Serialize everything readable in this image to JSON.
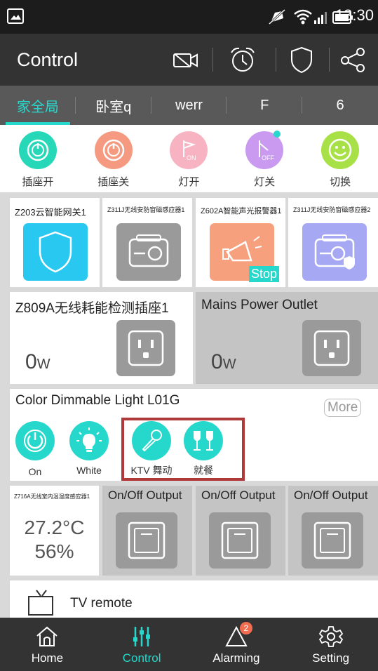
{
  "status_bar": {
    "time": "13:30"
  },
  "app_bar": {
    "title": "Control"
  },
  "tabs": [
    {
      "label": "家全局",
      "active": true
    },
    {
      "label": "卧室q"
    },
    {
      "label": "werr"
    },
    {
      "label": "F"
    },
    {
      "label": "6"
    }
  ],
  "scenes": [
    {
      "label": "插座开",
      "color": "#26d8b8",
      "icon": "power-on-icon"
    },
    {
      "label": "插座关",
      "color": "#f59a80",
      "icon": "power-off-icon"
    },
    {
      "label": "灯开",
      "color": "#f8b3c2",
      "icon": "light-on-icon",
      "icon_text": "ON"
    },
    {
      "label": "灯关",
      "color": "#c99af0",
      "icon": "light-off-icon",
      "icon_text": "OFF"
    },
    {
      "label": "切换",
      "color": "#a8e048",
      "icon": "smiley-icon"
    }
  ],
  "devices_row1": [
    {
      "title": "Z203云智能网关1",
      "tile_color": "#29c8f0",
      "icon": "shield-icon"
    },
    {
      "title": "Z311J无线安防窗磁感应器1",
      "tile_color": "#9a9a9a",
      "icon": "door-sensor-icon"
    },
    {
      "title": "Z602A智能声光报警器1",
      "tile_color": "#f7a07d",
      "icon": "megaphone-icon",
      "badge": "Stop"
    },
    {
      "title": "Z311J无线安防窗磁感应器2",
      "tile_color": "#a6a8f3",
      "icon": "door-sensor-shield-icon"
    }
  ],
  "outlets": [
    {
      "title": "Z809A无线耗能检测插座1",
      "value": "0",
      "unit": "W"
    },
    {
      "title": "Mains Power Outlet",
      "value": "0",
      "unit": "W"
    }
  ],
  "light": {
    "title": "Color Dimmable Light L01G",
    "more": "More",
    "buttons": [
      {
        "label": "On",
        "icon": "power-icon"
      },
      {
        "label": "White",
        "icon": "bulb-icon"
      },
      {
        "label": "KTV 舞动",
        "icon": "microphone-icon"
      },
      {
        "label": "就餐",
        "icon": "wine-glasses-icon"
      }
    ]
  },
  "sensor": {
    "title": "Z716A无线室内温湿度感应器1",
    "temperature": "27.2°C",
    "humidity": "56%"
  },
  "outputs": [
    {
      "title": "On/Off Output"
    },
    {
      "title": "On/Off Output"
    },
    {
      "title": "On/Off Output"
    }
  ],
  "tv": {
    "label": "TV remote"
  },
  "bottom_nav": [
    {
      "label": "Home",
      "icon": "home-icon"
    },
    {
      "label": "Control",
      "icon": "control-sliders-icon",
      "active": true
    },
    {
      "label": "Alarming",
      "icon": "alarm-bell-icon",
      "badge": "2"
    },
    {
      "label": "Setting",
      "icon": "settings-gear-icon"
    }
  ],
  "colors": {
    "accent": "#26d8cc",
    "highlight_box": "#b03a3a",
    "tile_gray": "#9a9a9a",
    "appbar": "#333333"
  }
}
